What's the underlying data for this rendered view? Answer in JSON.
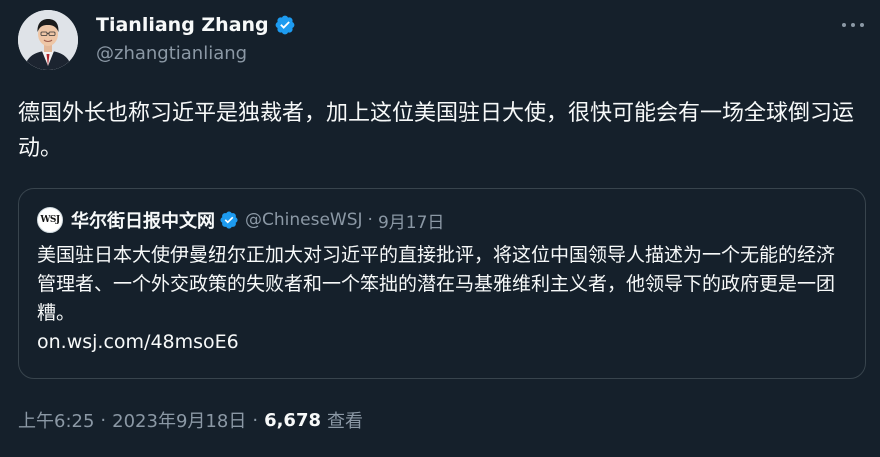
{
  "author": {
    "name": "Tianliang Zhang",
    "handle": "@zhangtianliang",
    "verified": true
  },
  "tweet": {
    "text": "德国外长也称习近平是独裁者，加上这位美国驻日大使，很快可能会有一场全球倒习运动。"
  },
  "quoted": {
    "logo_text": "WSJ",
    "name": "华尔街日报中文网",
    "handle": "@ChineseWSJ",
    "separator": "·",
    "date": "9月17日",
    "text": "美国驻日本大使伊曼纽尔正加大对习近平的直接批评，将这位中国领导人描述为一个无能的经济管理者、一个外交政策的失败者和一个笨拙的潜在马基雅维利主义者，他领导下的政府更是一团糟。",
    "link": "on.wsj.com/48msoE6"
  },
  "meta": {
    "time": "上午6:25",
    "separator": "·",
    "date": "2023年9月18日",
    "views": "6,678",
    "views_label": "查看"
  },
  "colors": {
    "background": "#15202b",
    "text": "#f7f9f9",
    "secondary": "#8b98a5",
    "verified": "#1d9bf0",
    "border": "#38444d"
  }
}
